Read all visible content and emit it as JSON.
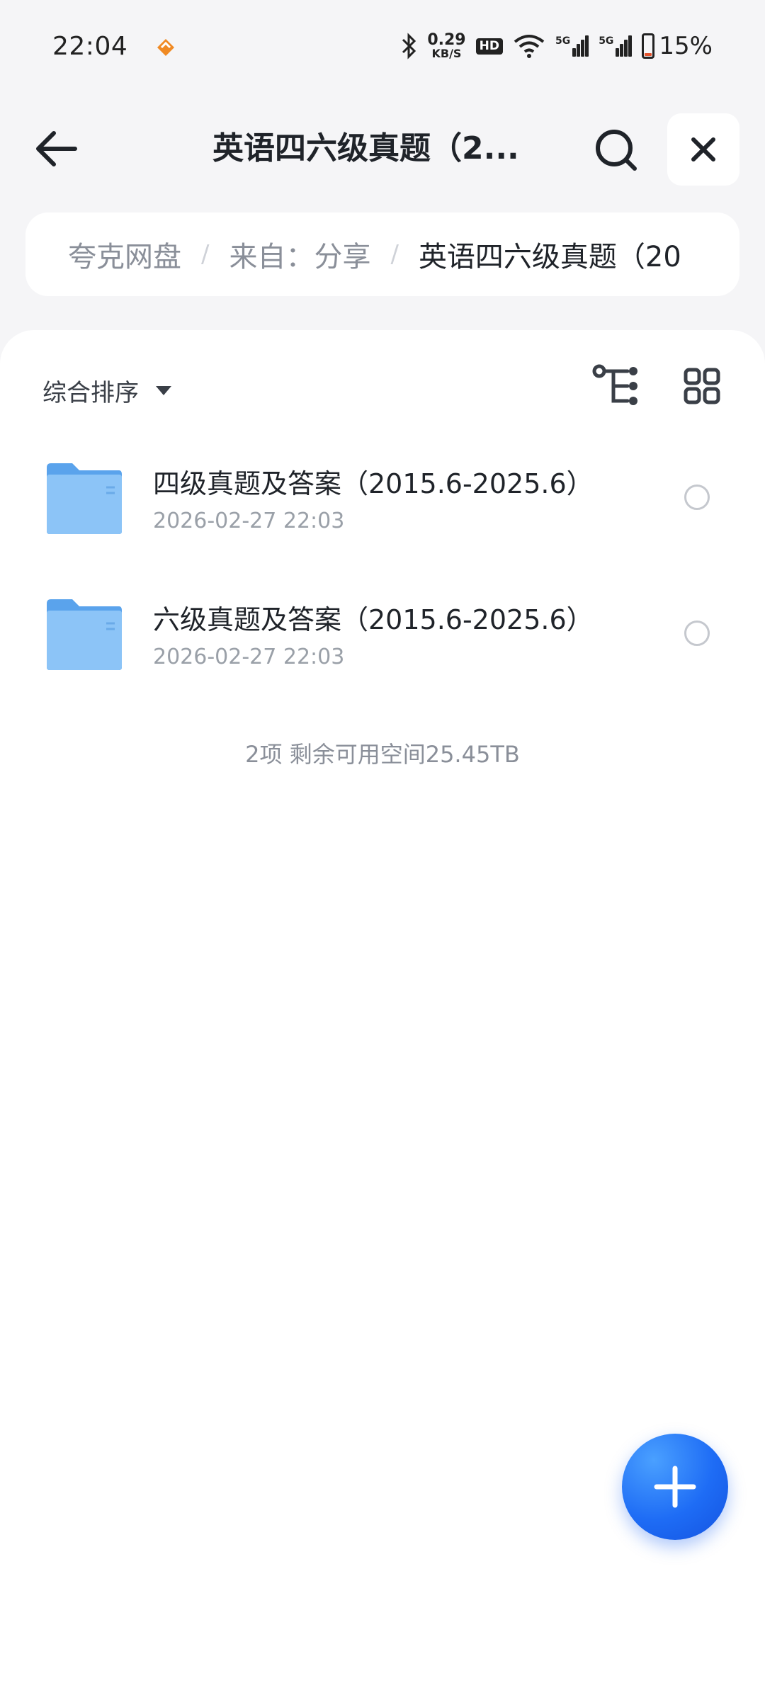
{
  "status_bar": {
    "time": "22:04",
    "net_speed_value": "0.29",
    "net_speed_unit": "KB/S",
    "hd_badge": "HD",
    "sim1": "5G",
    "sim2": "5G",
    "battery": "15%",
    "battery_level_percent": 15,
    "app_icon": "heart-badge-icon",
    "app_icon_color": "#f08a24"
  },
  "header": {
    "title": "英语四六级真题（2...",
    "back_icon": "arrow-left-icon",
    "search_icon": "search-icon",
    "close_icon": "close-icon"
  },
  "breadcrumb": {
    "items": [
      "夸克网盘",
      "来自：分享",
      "英语四六级真题（20"
    ],
    "separator": "/"
  },
  "toolbar": {
    "sort_label": "综合排序",
    "sort_caret_icon": "caret-down-icon",
    "tree_view_icon": "tree-view-icon",
    "grid_view_icon": "grid-view-icon"
  },
  "files": [
    {
      "name": "四级真题及答案（2015.6-2025.6）",
      "date": "2026-02-27 22:03",
      "icon": "folder-icon"
    },
    {
      "name": "六级真题及答案（2015.6-2025.6）",
      "date": "2026-02-27 22:03",
      "icon": "folder-icon"
    }
  ],
  "summary": "2项 剩余可用空间25.45TB",
  "fab": {
    "icon": "plus-icon",
    "color": "#1e6cf5"
  },
  "colors": {
    "accent": "#1e6cf5",
    "folder": "#6fb3f2",
    "background": "#f5f5f7"
  }
}
